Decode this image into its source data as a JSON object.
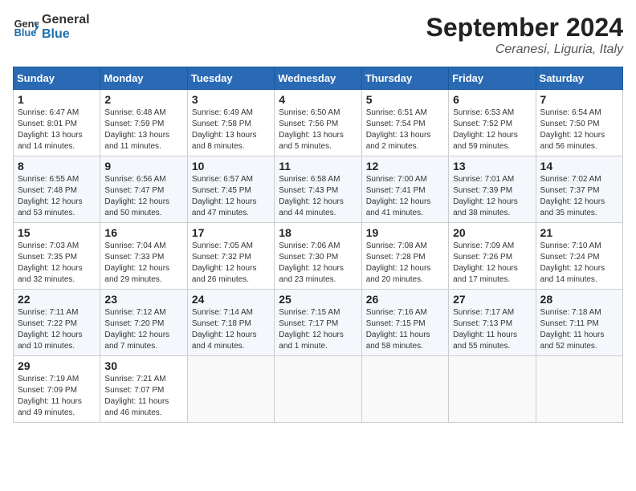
{
  "header": {
    "logo_text_general": "General",
    "logo_text_blue": "Blue",
    "month_title": "September 2024",
    "subtitle": "Ceranesi, Liguria, Italy"
  },
  "calendar": {
    "days_of_week": [
      "Sunday",
      "Monday",
      "Tuesday",
      "Wednesday",
      "Thursday",
      "Friday",
      "Saturday"
    ],
    "weeks": [
      [
        null,
        null,
        null,
        null,
        {
          "day": 5,
          "sunrise": "6:51 AM",
          "sunset": "7:54 PM",
          "daylight": "13 hours and 2 minutes"
        },
        {
          "day": 6,
          "sunrise": "6:53 AM",
          "sunset": "7:52 PM",
          "daylight": "12 hours and 59 minutes"
        },
        {
          "day": 7,
          "sunrise": "6:54 AM",
          "sunset": "7:50 PM",
          "daylight": "12 hours and 56 minutes"
        }
      ],
      [
        {
          "day": 1,
          "sunrise": "6:47 AM",
          "sunset": "8:01 PM",
          "daylight": "13 hours and 14 minutes"
        },
        {
          "day": 2,
          "sunrise": "6:48 AM",
          "sunset": "7:59 PM",
          "daylight": "13 hours and 11 minutes"
        },
        {
          "day": 3,
          "sunrise": "6:49 AM",
          "sunset": "7:58 PM",
          "daylight": "13 hours and 8 minutes"
        },
        {
          "day": 4,
          "sunrise": "6:50 AM",
          "sunset": "7:56 PM",
          "daylight": "13 hours and 5 minutes"
        },
        {
          "day": 5,
          "sunrise": "6:51 AM",
          "sunset": "7:54 PM",
          "daylight": "13 hours and 2 minutes"
        },
        {
          "day": 6,
          "sunrise": "6:53 AM",
          "sunset": "7:52 PM",
          "daylight": "12 hours and 59 minutes"
        },
        {
          "day": 7,
          "sunrise": "6:54 AM",
          "sunset": "7:50 PM",
          "daylight": "12 hours and 56 minutes"
        }
      ],
      [
        {
          "day": 8,
          "sunrise": "6:55 AM",
          "sunset": "7:48 PM",
          "daylight": "12 hours and 53 minutes"
        },
        {
          "day": 9,
          "sunrise": "6:56 AM",
          "sunset": "7:47 PM",
          "daylight": "12 hours and 50 minutes"
        },
        {
          "day": 10,
          "sunrise": "6:57 AM",
          "sunset": "7:45 PM",
          "daylight": "12 hours and 47 minutes"
        },
        {
          "day": 11,
          "sunrise": "6:58 AM",
          "sunset": "7:43 PM",
          "daylight": "12 hours and 44 minutes"
        },
        {
          "day": 12,
          "sunrise": "7:00 AM",
          "sunset": "7:41 PM",
          "daylight": "12 hours and 41 minutes"
        },
        {
          "day": 13,
          "sunrise": "7:01 AM",
          "sunset": "7:39 PM",
          "daylight": "12 hours and 38 minutes"
        },
        {
          "day": 14,
          "sunrise": "7:02 AM",
          "sunset": "7:37 PM",
          "daylight": "12 hours and 35 minutes"
        }
      ],
      [
        {
          "day": 15,
          "sunrise": "7:03 AM",
          "sunset": "7:35 PM",
          "daylight": "12 hours and 32 minutes"
        },
        {
          "day": 16,
          "sunrise": "7:04 AM",
          "sunset": "7:33 PM",
          "daylight": "12 hours and 29 minutes"
        },
        {
          "day": 17,
          "sunrise": "7:05 AM",
          "sunset": "7:32 PM",
          "daylight": "12 hours and 26 minutes"
        },
        {
          "day": 18,
          "sunrise": "7:06 AM",
          "sunset": "7:30 PM",
          "daylight": "12 hours and 23 minutes"
        },
        {
          "day": 19,
          "sunrise": "7:08 AM",
          "sunset": "7:28 PM",
          "daylight": "12 hours and 20 minutes"
        },
        {
          "day": 20,
          "sunrise": "7:09 AM",
          "sunset": "7:26 PM",
          "daylight": "12 hours and 17 minutes"
        },
        {
          "day": 21,
          "sunrise": "7:10 AM",
          "sunset": "7:24 PM",
          "daylight": "12 hours and 14 minutes"
        }
      ],
      [
        {
          "day": 22,
          "sunrise": "7:11 AM",
          "sunset": "7:22 PM",
          "daylight": "12 hours and 10 minutes"
        },
        {
          "day": 23,
          "sunrise": "7:12 AM",
          "sunset": "7:20 PM",
          "daylight": "12 hours and 7 minutes"
        },
        {
          "day": 24,
          "sunrise": "7:14 AM",
          "sunset": "7:18 PM",
          "daylight": "12 hours and 4 minutes"
        },
        {
          "day": 25,
          "sunrise": "7:15 AM",
          "sunset": "7:17 PM",
          "daylight": "12 hours and 1 minute"
        },
        {
          "day": 26,
          "sunrise": "7:16 AM",
          "sunset": "7:15 PM",
          "daylight": "11 hours and 58 minutes"
        },
        {
          "day": 27,
          "sunrise": "7:17 AM",
          "sunset": "7:13 PM",
          "daylight": "11 hours and 55 minutes"
        },
        {
          "day": 28,
          "sunrise": "7:18 AM",
          "sunset": "7:11 PM",
          "daylight": "11 hours and 52 minutes"
        }
      ],
      [
        {
          "day": 29,
          "sunrise": "7:19 AM",
          "sunset": "7:09 PM",
          "daylight": "11 hours and 49 minutes"
        },
        {
          "day": 30,
          "sunrise": "7:21 AM",
          "sunset": "7:07 PM",
          "daylight": "11 hours and 46 minutes"
        },
        null,
        null,
        null,
        null,
        null
      ]
    ]
  }
}
